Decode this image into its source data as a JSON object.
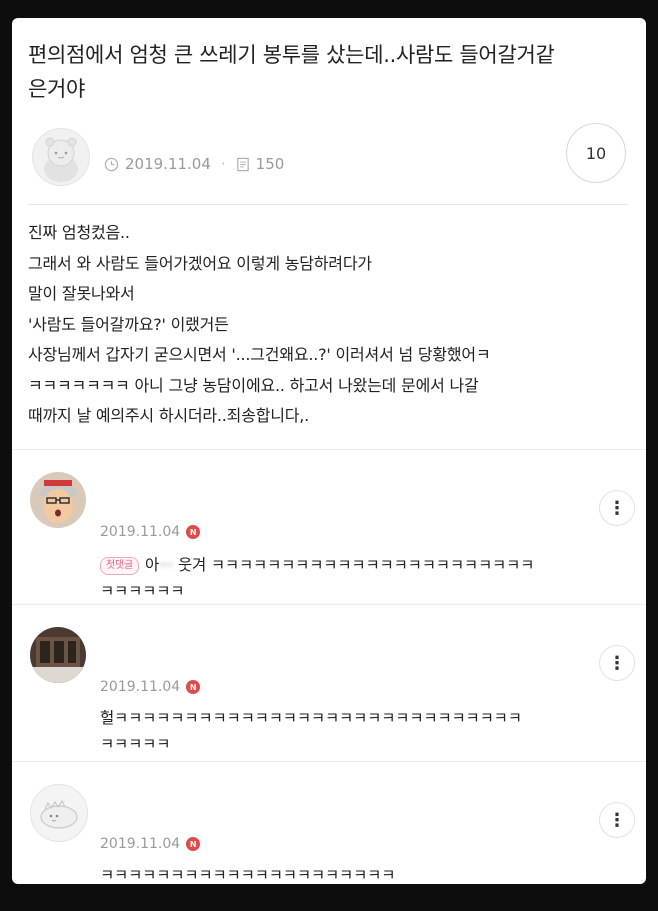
{
  "post": {
    "title_line1": "편의점에서 엄청 큰 쓰레기 봉투를 샀는데..사람도 들어갈거같",
    "title_line2": "은거야",
    "date": "2019.11.04",
    "views": "150",
    "comment_count": "10",
    "body_lines": [
      "진짜 엄청컸음..",
      "그래서 와 사람도 들어가겠어요 이렇게 농담하려다가",
      "말이 잘못나와서",
      "'사람도 들어갈까요?' 이랬거든",
      "사장님께서 갑자기 굳으시면서 '...그건왜요..?' 이러셔서 넘 당황했어ㅋ",
      "ㅋㅋㅋㅋㅋㅋㅋ 아니 그냥 농담이에요.. 하고서 나왔는데 문에서 나갈",
      "때까지 날 예의주시 하시더라..죄송합니다,."
    ]
  },
  "comments": [
    {
      "date": "2019.11.04",
      "badge": "N",
      "tag": "첫댓글",
      "text_start": "아",
      "text_blurred": "···",
      "text_rest": " 웃겨 ㅋㅋㅋㅋㅋㅋㅋㅋㅋㅋㅋㅋㅋㅋㅋㅋㅋㅋㅋㅋㅋㅋㅋ",
      "text_line2": "ㅋㅋㅋㅋㅋㅋ",
      "more": "⋮"
    },
    {
      "date": "2019.11.04",
      "badge": "N",
      "text_line1": "헐ㅋㅋㅋㅋㅋㅋㅋㅋㅋㅋㅋㅋㅋㅋㅋㅋㅋㅋㅋㅋㅋㅋㅋㅋㅋㅋㅋㅋㅋ",
      "text_line2": "ㅋㅋㅋㅋㅋ",
      "more": "⋮"
    },
    {
      "date": "2019.11.04",
      "badge": "N",
      "text_line1": "ㅋㅋㅋㅋㅋㅋㅋㅋㅋㅋㅋㅋㅋㅋㅋㅋㅋㅋㅋㅋㅋ",
      "more": "⋮"
    }
  ],
  "icons": {
    "clock": "clock-icon",
    "views": "document-icon",
    "more": "more-vertical-icon",
    "new_badge": "new-badge-icon"
  },
  "colors": {
    "badge_red": "#e04a4a",
    "meta_gray": "#9a9a9a"
  }
}
